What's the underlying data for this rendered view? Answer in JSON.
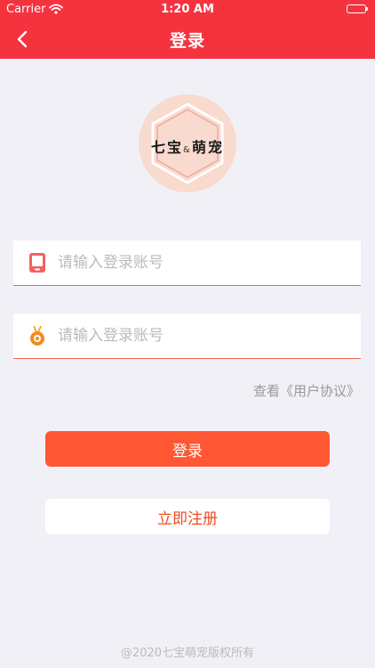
{
  "status_bar": {
    "carrier": "Carrier",
    "time": "1:20 AM"
  },
  "nav": {
    "title": "登录",
    "back_icon": "chevron-left-icon"
  },
  "logo": {
    "text_left": "七宝",
    "ampersand": "&",
    "text_right": "萌宠"
  },
  "form": {
    "account_placeholder": "请输入登录账号",
    "account_icon": "phone-icon",
    "password_placeholder": "请输入登录账号",
    "password_icon": "medal-icon"
  },
  "agreement_link": "查看《用户协议》",
  "buttons": {
    "login": "登录",
    "register": "立即注册"
  },
  "footer": {
    "copyright": "@2020七宝萌宠版权所有"
  },
  "colors": {
    "primary": "#F5333F",
    "button": "#FF5733",
    "background": "#F1F0F6"
  }
}
